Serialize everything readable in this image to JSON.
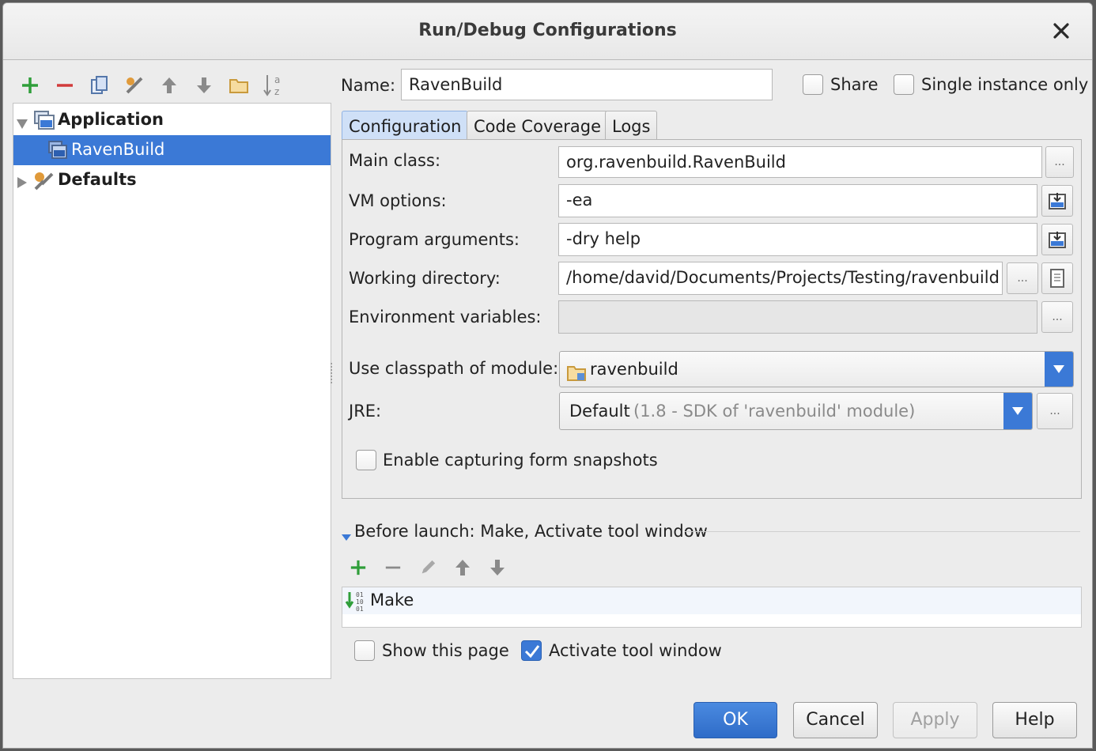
{
  "window": {
    "title": "Run/Debug Configurations"
  },
  "toolbar": {
    "icons": [
      "add-icon",
      "remove-icon",
      "copy-icon",
      "edit-defaults-icon",
      "move-up-icon",
      "move-down-icon",
      "folder-icon",
      "sort-icon"
    ]
  },
  "tree": {
    "items": [
      {
        "label": "Application",
        "expanded": true
      },
      {
        "label": "RavenBuild",
        "selected": true
      },
      {
        "label": "Defaults",
        "expanded": false
      }
    ]
  },
  "header": {
    "name_label": "Name:",
    "name_value": "RavenBuild",
    "share_label": "Share",
    "single_instance_label": "Single instance only"
  },
  "tabs": [
    "Configuration",
    "Code Coverage",
    "Logs"
  ],
  "form": {
    "main_class_label": "Main class:",
    "main_class_value": "org.ravenbuild.RavenBuild",
    "vm_options_label": "VM options:",
    "vm_options_value": "-ea",
    "program_args_label": "Program arguments:",
    "program_args_value": "-dry help",
    "working_dir_label": "Working directory:",
    "working_dir_value": "/home/david/Documents/Projects/Testing/ravenbuild",
    "env_vars_label": "Environment variables:",
    "env_vars_value": "",
    "classpath_label": "Use classpath of module:",
    "classpath_value": "ravenbuild",
    "jre_label": "JRE:",
    "jre_value": "Default",
    "jre_detail": "(1.8 - SDK of 'ravenbuild' module)",
    "snapshots_label": "Enable capturing form snapshots",
    "ellipsis": "..."
  },
  "before_launch": {
    "header": "Before launch: Make, Activate tool window",
    "tasks": [
      "Make"
    ]
  },
  "options": {
    "show_page_label": "Show this page",
    "show_page_checked": false,
    "activate_tool_label": "Activate tool window",
    "activate_tool_checked": true
  },
  "buttons": {
    "ok": "OK",
    "cancel": "Cancel",
    "apply": "Apply",
    "help": "Help"
  },
  "colors": {
    "accent": "#3b79d6",
    "add_green": "#2f9e3a",
    "remove_red": "#d23b3b"
  }
}
